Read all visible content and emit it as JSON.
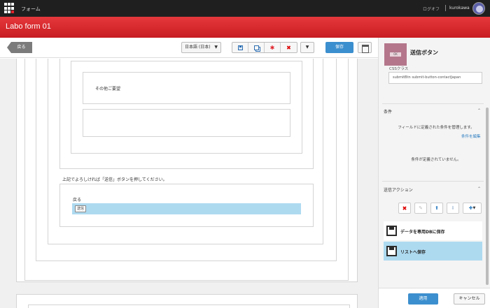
{
  "topbar": {
    "app_name": "フォーム",
    "logout_label": "ログオフ",
    "user_name": "kurokawa"
  },
  "header": {
    "form_title": "Labo form 01"
  },
  "toolbar": {
    "back_label": "戻る",
    "language_value": "日本語 (日本)",
    "save_label": "保存"
  },
  "canvas": {
    "comment_label": "その他ご要望",
    "instruction_text": "上記でよろしければ「送信」ボタンを押してください。",
    "back_text": "戻る",
    "submit_label": "送信"
  },
  "panel": {
    "element_title": "送信ボタン",
    "css_class_label": "CSSクラス",
    "css_class_value": "submitBtn submit-button-contactJapan",
    "conditions": {
      "title": "条件",
      "description": "フィールドに定義された条件を管理します。",
      "edit_link": "条件を編集",
      "empty_text": "条件が定義されていません。"
    },
    "actions": {
      "title": "送信アクション",
      "items": [
        {
          "label": "データを専用DBに保存",
          "selected": false
        },
        {
          "label": "リストへ保存",
          "selected": true
        }
      ]
    },
    "apply_label": "適用",
    "cancel_label": "キャンセル"
  },
  "colors": {
    "header_red": "#d42a2e",
    "primary_blue": "#3c8fce",
    "selection_blue": "#aedaf0"
  }
}
